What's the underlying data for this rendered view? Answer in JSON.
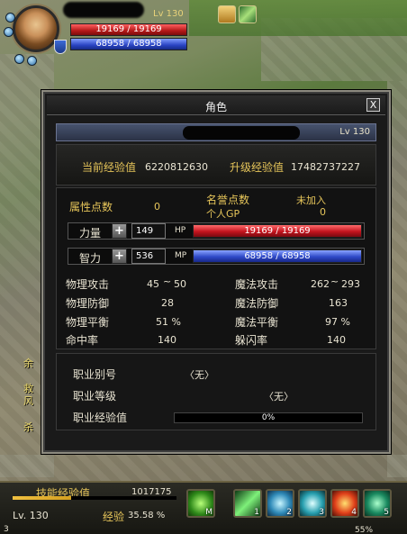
{
  "player": {
    "level": "Lv 130",
    "hp": "19169 / 19169",
    "mp": "68958 / 68958"
  },
  "window": {
    "title": "角色",
    "close_label": "X",
    "char_level": "Lv 130"
  },
  "experience": {
    "current_label": "当前经验值",
    "current_value": "6220812630",
    "upgrade_label": "升级经验值",
    "upgrade_value": "17482737227"
  },
  "attributes": {
    "attr_points_label": "属性点数",
    "attr_points_value": "0",
    "fame_label": "名誉点数",
    "fame_value": "未加入",
    "gp_label": "个人GP",
    "gp_value": "0",
    "strength_label": "力量",
    "strength_value": "149",
    "hp_tag": "HP",
    "hp_value": "19169 / 19169",
    "intel_label": "智力",
    "intel_value": "536",
    "mp_tag": "MP",
    "mp_value": "68958 / 68958",
    "plus_label": "+"
  },
  "combat": {
    "phys_atk_label": "物理攻击",
    "phys_atk_min": "45",
    "phys_atk_sep": "~",
    "phys_atk_max": "50",
    "mag_atk_label": "魔法攻击",
    "mag_atk_min": "262",
    "mag_atk_sep": "~",
    "mag_atk_max": "293",
    "phys_def_label": "物理防御",
    "phys_def_value": "28",
    "mag_def_label": "魔法防御",
    "mag_def_value": "163",
    "phys_bal_label": "物理平衡",
    "phys_bal_value": "51 %",
    "mag_bal_label": "魔法平衡",
    "mag_bal_value": "97 %",
    "hit_label": "命中率",
    "hit_value": "140",
    "dodge_label": "躲闪率",
    "dodge_value": "140"
  },
  "job": {
    "alias_label": "职业别号",
    "alias_value": "〈无〉",
    "rank_label": "职业等级",
    "rank_value": "〈无〉",
    "exp_label": "职业经验值",
    "exp_value": "0%",
    "exp_fraction": 0
  },
  "hud": {
    "skill_exp_label": "技能经验值",
    "skill_exp_value": "1017175",
    "level": "Lv. 130",
    "exp_label": "经验",
    "exp_value": "35.58 %",
    "exp_fraction": 0.3558,
    "bottom_left_num": "3",
    "bottom_percent": "55%",
    "slot_keys": [
      "M",
      "1",
      "2",
      "3",
      "4",
      "5"
    ]
  },
  "side_texts": [
    "余",
    "救",
    "风",
    "杀"
  ],
  "colors": {
    "hp": "#c4141e",
    "mp": "#2f4ac8",
    "gold_text": "#e6c55a",
    "title_strip": "#47536e"
  },
  "icons": [
    "quest-scroll-icon",
    "map-icon",
    "close-icon",
    "plus-icon",
    "skill-icon"
  ]
}
